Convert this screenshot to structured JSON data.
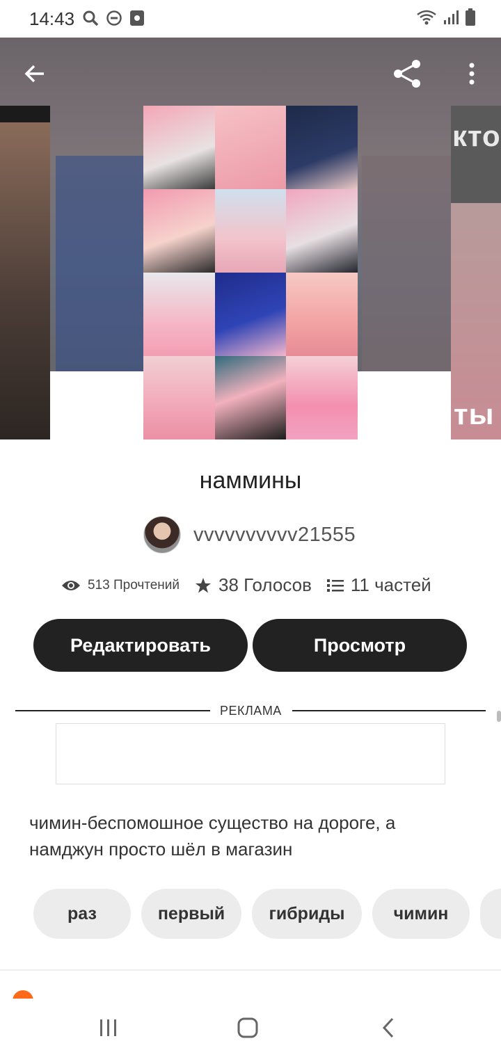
{
  "status_bar": {
    "time": "14:43",
    "left_icons": [
      "search-icon",
      "dnd-icon",
      "screenshot-icon"
    ],
    "right_icons": [
      "wifi-icon",
      "signal-icon",
      "battery-icon"
    ]
  },
  "app_bar": {
    "back_icon": "arrow-left-icon",
    "share_icon": "share-icon",
    "more_icon": "more-vertical-icon"
  },
  "side_covers": {
    "left_text": "",
    "right_text_top": "кто",
    "right_text_bottom": "ты н"
  },
  "story": {
    "title": "наммины",
    "author": "vvvvvvvvvv21555",
    "reads_label": "513 Прочтений",
    "votes_label": "38 Голосов",
    "parts_label": "11 частей",
    "description": "чимин-беспомошное существо на дороге, а намджун просто шёл в магазин"
  },
  "actions": {
    "edit_label": "Редактировать",
    "view_label": "Просмотр"
  },
  "ad": {
    "label": "РЕКЛАМА"
  },
  "tags": [
    {
      "label": "раз"
    },
    {
      "label": "первый"
    },
    {
      "label": "гибриды"
    },
    {
      "label": "чимин"
    }
  ],
  "nav_bar": {
    "recents_icon": "recent-apps-icon",
    "home_icon": "home-icon",
    "back_icon": "nav-back-icon"
  },
  "colors": {
    "button_dark": "#222222",
    "tag_bg": "#ececec",
    "accent_orange": "#ff6a1a"
  }
}
